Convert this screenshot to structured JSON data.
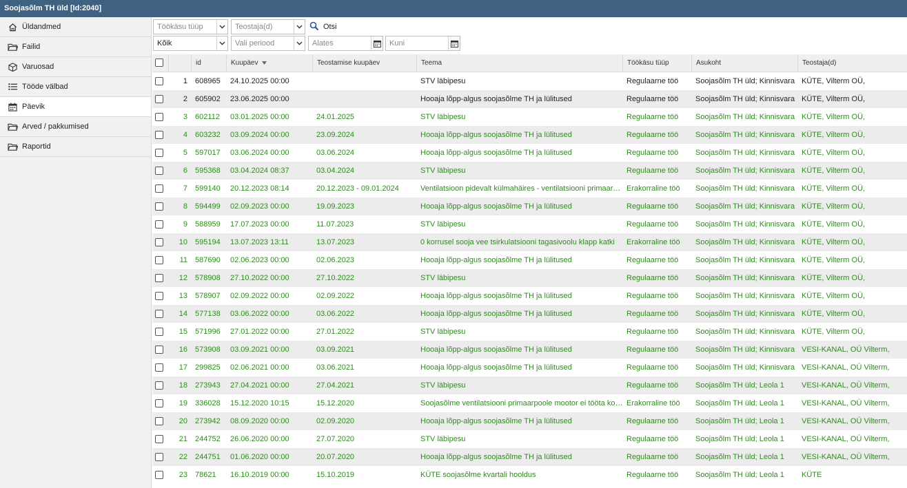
{
  "window": {
    "title": "Soojasõlm TH üld [Id:2040]"
  },
  "sidebar": {
    "items": [
      {
        "label": "Üldandmed",
        "icon": "home-icon"
      },
      {
        "label": "Failid",
        "icon": "folder-icon"
      },
      {
        "label": "Varuosad",
        "icon": "box-icon"
      },
      {
        "label": "Tööde välbad",
        "icon": "list-icon"
      },
      {
        "label": "Päevik",
        "icon": "calendar-icon"
      },
      {
        "label": "Arved / pakkumised",
        "icon": "folder-icon"
      },
      {
        "label": "Raportid",
        "icon": "folder-icon"
      }
    ]
  },
  "filters": {
    "work_type_placeholder": "Töökäsu tüüp",
    "performer_placeholder": "Teostaja(d)",
    "search_label": "Otsi",
    "status_value": "Kõik",
    "period_placeholder": "Vali periood",
    "from_placeholder": "Alates",
    "to_placeholder": "Kuni"
  },
  "table": {
    "headers": {
      "id": "id",
      "ordered": "Kuupäev",
      "done": "Teostamise kuupäev",
      "subject": "Teema",
      "type": "Töökäsu tüüp",
      "location": "Asukoht",
      "performer": "Teostaja(d)"
    },
    "rows": [
      {
        "nr": "1",
        "id": "608965",
        "ordered": "24.10.2025 00:00",
        "done": "",
        "subject": "STV läbipesu",
        "type": "Regulaarne töö",
        "location": "Soojasõlm TH üld; Kinnisvara",
        "performer": "KÜTE, Vilterm OÜ,",
        "status": "black"
      },
      {
        "nr": "2",
        "id": "605902",
        "ordered": "23.06.2025 00:00",
        "done": "",
        "subject": "Hooaja lõpp-algus soojasõlme TH ja lülitused",
        "type": "Regulaarne töö",
        "location": "Soojasõlm TH üld; Kinnisvara",
        "performer": "KÜTE, Vilterm OÜ,",
        "status": "black"
      },
      {
        "nr": "3",
        "id": "602112",
        "ordered": "03.01.2025 00:00",
        "done": "24.01.2025",
        "subject": "STV läbipesu",
        "type": "Regulaarne töö",
        "location": "Soojasõlm TH üld; Kinnisvara",
        "performer": "KÜTE, Vilterm OÜ,",
        "status": "green"
      },
      {
        "nr": "4",
        "id": "603232",
        "ordered": "03.09.2024 00:00",
        "done": "23.09.2024",
        "subject": "Hooaja lõpp-algus soojasõlme TH ja lülitused",
        "type": "Regulaarne töö",
        "location": "Soojasõlm TH üld; Kinnisvara",
        "performer": "KÜTE, Vilterm OÜ,",
        "status": "green"
      },
      {
        "nr": "5",
        "id": "597017",
        "ordered": "03.06.2024 00:00",
        "done": "03.06.2024",
        "subject": "Hooaja lõpp-algus soojasõlme TH ja lülitused",
        "type": "Regulaarne töö",
        "location": "Soojasõlm TH üld; Kinnisvara",
        "performer": "KÜTE, Vilterm OÜ,",
        "status": "green"
      },
      {
        "nr": "6",
        "id": "595368",
        "ordered": "03.04.2024 08:37",
        "done": "03.04.2024",
        "subject": "STV läbipesu",
        "type": "Regulaarne töö",
        "location": "Soojasõlm TH üld; Kinnisvara",
        "performer": "KÜTE, Vilterm OÜ,",
        "status": "green"
      },
      {
        "nr": "7",
        "id": "599140",
        "ordered": "20.12.2023 08:14",
        "done": "20.12.2023 - 09.01.2024",
        "subject": "Ventilatsioon pidevalt külmahäires - ventilatsiooni primaarpoole",
        "type": "Erakorraline töö",
        "location": "Soojasõlm TH üld; Kinnisvara",
        "performer": "KÜTE, Vilterm OÜ,",
        "status": "green"
      },
      {
        "nr": "8",
        "id": "594499",
        "ordered": "02.09.2023 00:00",
        "done": "19.09.2023",
        "subject": "Hooaja lõpp-algus soojasõlme TH ja lülitused",
        "type": "Regulaarne töö",
        "location": "Soojasõlm TH üld; Kinnisvara",
        "performer": "KÜTE, Vilterm OÜ,",
        "status": "green"
      },
      {
        "nr": "9",
        "id": "588959",
        "ordered": "17.07.2023 00:00",
        "done": "11.07.2023",
        "subject": "STV läbipesu",
        "type": "Regulaarne töö",
        "location": "Soojasõlm TH üld; Kinnisvara",
        "performer": "KÜTE, Vilterm OÜ,",
        "status": "green"
      },
      {
        "nr": "10",
        "id": "595194",
        "ordered": "13.07.2023 13:11",
        "done": "13.07.2023",
        "subject": "0 korrusel sooja vee tsirkulatsiooni tagasivoolu klapp katki",
        "type": "Erakorraline töö",
        "location": "Soojasõlm TH üld; Kinnisvara",
        "performer": "KÜTE, Vilterm OÜ,",
        "status": "green"
      },
      {
        "nr": "11",
        "id": "587690",
        "ordered": "02.06.2023 00:00",
        "done": "02.06.2023",
        "subject": "Hooaja lõpp-algus soojasõlme TH ja lülitused",
        "type": "Regulaarne töö",
        "location": "Soojasõlm TH üld; Kinnisvara",
        "performer": "KÜTE, Vilterm OÜ,",
        "status": "green"
      },
      {
        "nr": "12",
        "id": "578908",
        "ordered": "27.10.2022 00:00",
        "done": "27.10.2022",
        "subject": "STV läbipesu",
        "type": "Regulaarne töö",
        "location": "Soojasõlm TH üld; Kinnisvara",
        "performer": "KÜTE, Vilterm OÜ,",
        "status": "green"
      },
      {
        "nr": "13",
        "id": "578907",
        "ordered": "02.09.2022 00:00",
        "done": "02.09.2022",
        "subject": "Hooaja lõpp-algus soojasõlme TH ja lülitused",
        "type": "Regulaarne töö",
        "location": "Soojasõlm TH üld; Kinnisvara",
        "performer": "KÜTE, Vilterm OÜ,",
        "status": "green"
      },
      {
        "nr": "14",
        "id": "577138",
        "ordered": "03.06.2022 00:00",
        "done": "03.06.2022",
        "subject": "Hooaja lõpp-algus soojasõlme TH ja lülitused",
        "type": "Regulaarne töö",
        "location": "Soojasõlm TH üld; Kinnisvara",
        "performer": "KÜTE, Vilterm OÜ,",
        "status": "green"
      },
      {
        "nr": "15",
        "id": "571996",
        "ordered": "27.01.2022 00:00",
        "done": "27.01.2022",
        "subject": "STV läbipesu",
        "type": "Regulaarne töö",
        "location": "Soojasõlm TH üld; Kinnisvara",
        "performer": "KÜTE, Vilterm OÜ,",
        "status": "green"
      },
      {
        "nr": "16",
        "id": "573908",
        "ordered": "03.09.2021 00:00",
        "done": "03.09.2021",
        "subject": "Hooaja lõpp-algus soojasõlme TH ja lülitused",
        "type": "Regulaarne töö",
        "location": "Soojasõlm TH üld; Kinnisvara",
        "performer": "VESI-KANAL, OÜ Vilterm,",
        "status": "green"
      },
      {
        "nr": "17",
        "id": "299825",
        "ordered": "02.06.2021 00:00",
        "done": "03.06.2021",
        "subject": "Hooaja lõpp-algus soojasõlme TH ja lülitused",
        "type": "Regulaarne töö",
        "location": "Soojasõlm TH üld; Kinnisvara",
        "performer": "VESI-KANAL, OÜ Vilterm,",
        "status": "green"
      },
      {
        "nr": "18",
        "id": "273943",
        "ordered": "27.04.2021 00:00",
        "done": "27.04.2021",
        "subject": "STV läbipesu",
        "type": "Regulaarne töö",
        "location": "Soojasõlm TH üld; Leola 1",
        "performer": "VESI-KANAL, OÜ Vilterm,",
        "status": "green"
      },
      {
        "nr": "19",
        "id": "336028",
        "ordered": "15.12.2020 10:15",
        "done": "15.12.2020",
        "subject": "Soojasõlme ventilatsiooni primaarpoole mootor ei tööta korralikult",
        "type": "Erakorraline töö",
        "location": "Soojasõlm TH üld; Leola 1",
        "performer": "VESI-KANAL, OÜ Vilterm,",
        "status": "green"
      },
      {
        "nr": "20",
        "id": "273942",
        "ordered": "08.09.2020 00:00",
        "done": "02.09.2020",
        "subject": "Hooaja lõpp-algus soojasõlme TH ja lülitused",
        "type": "Regulaarne töö",
        "location": "Soojasõlm TH üld; Leola 1",
        "performer": "VESI-KANAL, OÜ Vilterm,",
        "status": "green"
      },
      {
        "nr": "21",
        "id": "244752",
        "ordered": "26.06.2020 00:00",
        "done": "27.07.2020",
        "subject": "STV läbipesu",
        "type": "Regulaarne töö",
        "location": "Soojasõlm TH üld; Leola 1",
        "performer": "VESI-KANAL, OÜ Vilterm,",
        "status": "green"
      },
      {
        "nr": "22",
        "id": "244751",
        "ordered": "01.06.2020 00:00",
        "done": "20.07.2020",
        "subject": "Hooaja lõpp-algus soojasõlme TH ja lülitused",
        "type": "Regulaarne töö",
        "location": "Soojasõlm TH üld; Leola 1",
        "performer": "VESI-KANAL, OÜ Vilterm,",
        "status": "green"
      },
      {
        "nr": "23",
        "id": "78621",
        "ordered": "16.10.2019 00:00",
        "done": "15.10.2019",
        "subject": "KÜTE soojasõlme kvartali hooldus",
        "type": "Regulaarne töö",
        "location": "Soojasõlm TH üld; Leola 1",
        "performer": "KÜTE",
        "status": "green"
      }
    ]
  },
  "colors": {
    "titlebar": "#3e6280",
    "done_text": "#2e8b1e",
    "open_text": "#222222"
  }
}
